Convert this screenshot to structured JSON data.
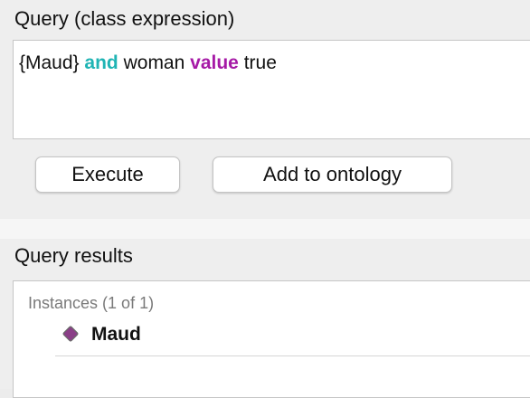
{
  "query_section": {
    "title": "Query (class expression)",
    "expression": {
      "part1": "{Maud}",
      "keyword_and": "and",
      "part2": "woman",
      "keyword_value": "value",
      "part3": "true"
    },
    "keyword_colors": {
      "and": "#1fb4b4",
      "value": "#a61aa6"
    }
  },
  "buttons": {
    "execute_label": "Execute",
    "add_to_ontology_label": "Add to ontology"
  },
  "results_section": {
    "title": "Query results",
    "instances_header": "Instances (1 of 1)",
    "instances": [
      {
        "label": "Maud",
        "icon": "individual-diamond-icon",
        "icon_color": "#8a3f87"
      }
    ]
  }
}
